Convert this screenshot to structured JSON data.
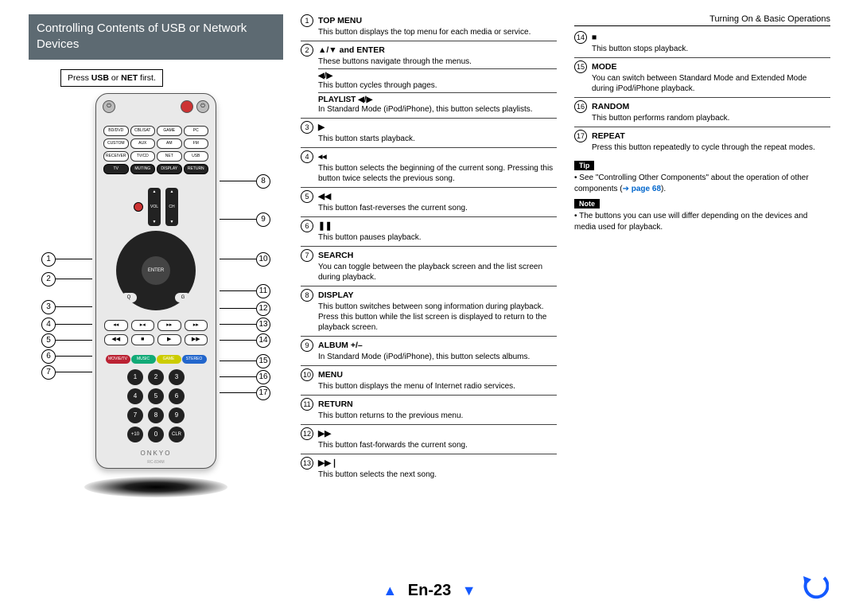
{
  "breadcrumb": "Turning On & Basic Operations",
  "title": "Controlling Contents of USB or Network Devices",
  "hint_pre": "Press ",
  "hint_b1": "USB",
  "hint_mid": " or ",
  "hint_b2": "NET",
  "hint_post": " first.",
  "brand": "ONKYO",
  "model": "RC-834M",
  "remote": {
    "src_row1": [
      "BD/DVD",
      "CBL/SAT",
      "GAME",
      "PC"
    ],
    "src_row2": [
      "CUSTOM",
      "AUX",
      "AM",
      "FM"
    ],
    "src_row3": [
      "RECEIVER",
      "TV/CD",
      "NET",
      "USB"
    ],
    "src_row4": [
      "TV",
      "MUTING",
      "DISPLAY",
      "RETURN"
    ],
    "rockers": [
      "VOL",
      "CH"
    ],
    "enter": "ENTER",
    "q": "Q",
    "g": "G",
    "transport1": [
      "◂◂",
      "▸◂",
      "▸▸",
      "▸▸"
    ],
    "transport2": [
      "◀◀",
      "■",
      "▶",
      "▶▶"
    ],
    "colors": [
      {
        "lab": "MOVIE/TV",
        "c": "#b23"
      },
      {
        "lab": "MUSIC",
        "c": "#1a7"
      },
      {
        "lab": "GAME",
        "c": "#cc0"
      },
      {
        "lab": "STEREO",
        "c": "#26c"
      }
    ],
    "nums": [
      [
        "1",
        "2",
        "3"
      ],
      [
        "4",
        "5",
        "6"
      ],
      [
        "7",
        "8",
        "9"
      ],
      [
        "+10",
        "0",
        "CLR"
      ]
    ]
  },
  "callouts_left": [
    "1",
    "2",
    "3",
    "4",
    "5",
    "6",
    "7"
  ],
  "callouts_right": [
    "8",
    "9",
    "10",
    "11",
    "12",
    "13",
    "14",
    "15",
    "16",
    "17"
  ],
  "col2": [
    {
      "n": "1",
      "title": "TOP MENU",
      "desc": "This button displays the top menu for each media or service."
    },
    {
      "n": "2",
      "title": "▲/▼ and ENTER",
      "desc": "These buttons navigate through the menus.",
      "sub": [
        {
          "t": "◀/▶",
          "d": "This button cycles through pages."
        },
        {
          "t": "PLAYLIST ◀/▶",
          "d": "In Standard Mode (iPod/iPhone), this button selects playlists."
        }
      ]
    },
    {
      "n": "3",
      "title": "▶",
      "desc": "This button starts playback."
    },
    {
      "n": "4",
      "title": "◂◂",
      "desc": "This button selects the beginning of the current song. Pressing this button twice selects the previous song."
    },
    {
      "n": "5",
      "title": "◀◀",
      "desc": "This button fast-reverses the current song."
    },
    {
      "n": "6",
      "title": "❚❚",
      "desc": "This button pauses playback."
    },
    {
      "n": "7",
      "title": "SEARCH",
      "desc": "You can toggle between the playback screen and the list screen during playback."
    },
    {
      "n": "8",
      "title": "DISPLAY",
      "desc": "This button switches between song information during playback.",
      "desc2": "Press this button while the list screen is displayed to return to the playback screen."
    },
    {
      "n": "9",
      "title": "ALBUM +/–",
      "desc": "In Standard Mode (iPod/iPhone), this button selects albums."
    },
    {
      "n": "10",
      "title": "MENU",
      "desc": "This button displays the menu of Internet radio services."
    },
    {
      "n": "11",
      "title": "RETURN",
      "desc": "This button returns to the previous menu."
    },
    {
      "n": "12",
      "title": "▶▶",
      "desc": "This button fast-forwards the current song."
    },
    {
      "n": "13",
      "title": "▶▶❘",
      "desc": "This button selects the next song."
    }
  ],
  "col3": [
    {
      "n": "14",
      "title": "■",
      "desc": "This button stops playback."
    },
    {
      "n": "15",
      "title": "MODE",
      "desc": "You can switch between Standard Mode and Extended Mode during iPod/iPhone playback."
    },
    {
      "n": "16",
      "title": "RANDOM",
      "desc": "This button performs random playback."
    },
    {
      "n": "17",
      "title": "REPEAT",
      "desc": "Press this button repeatedly to cycle through the repeat modes."
    }
  ],
  "tip_label": "Tip",
  "tip_text_pre": "See \"Controlling Other Components\" about the operation of other components (",
  "tip_link_arrow": "➔",
  "tip_link": "page 68",
  "tip_text_post": ").",
  "note_label": "Note",
  "note_text": "The buttons you can use will differ depending on the devices and media used for playback.",
  "footer_label": "En-23"
}
